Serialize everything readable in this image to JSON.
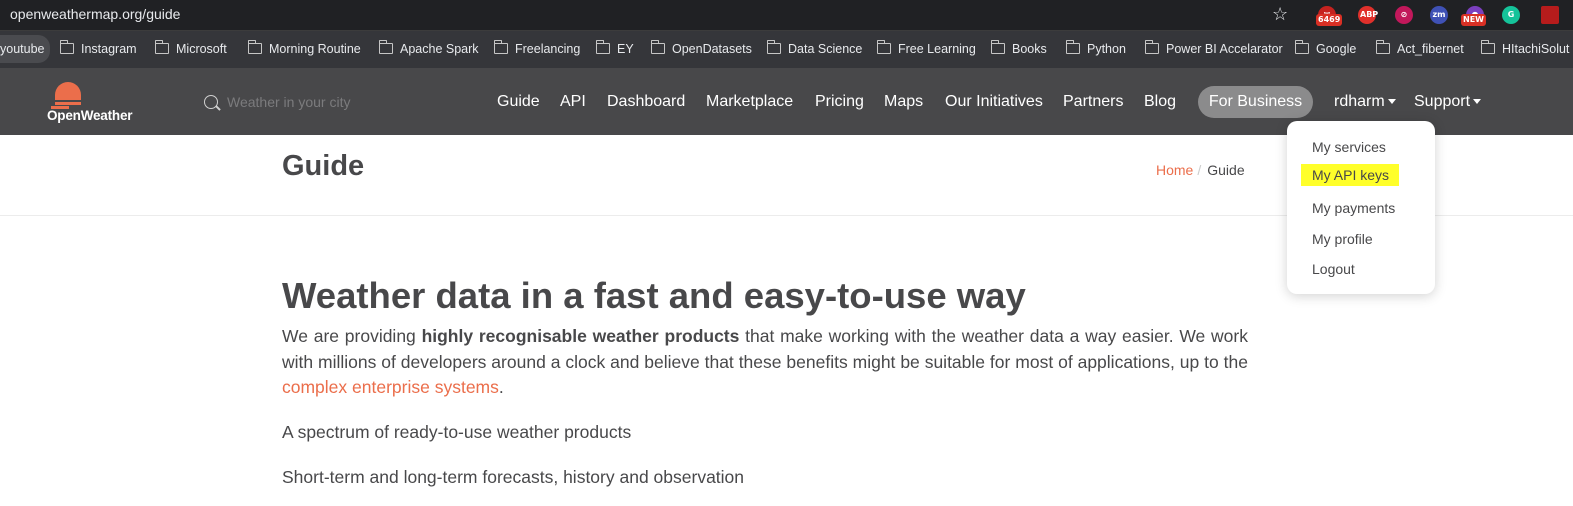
{
  "browser": {
    "url": "openweathermap.org/guide",
    "extensions": [
      {
        "name": "gmail-extension-icon",
        "badge": "6469"
      },
      {
        "name": "adblock-plus-icon",
        "label": "ABP"
      },
      {
        "name": "block-icon",
        "label": "⊘"
      },
      {
        "name": "zoom-icon",
        "label": "zm"
      },
      {
        "name": "new-extension-icon",
        "badge": "NEW"
      },
      {
        "name": "grammarly-icon",
        "label": "G"
      }
    ]
  },
  "bookmarks": [
    "youtube",
    "Instagram",
    "Microsoft",
    "Morning Routine",
    "Apache Spark",
    "Freelancing",
    "EY",
    "OpenDatasets",
    "Data Science",
    "Free Learning",
    "Books",
    "Python",
    "Power BI Accelarator",
    "Google",
    "Act_fibernet",
    "HItachiSolut"
  ],
  "nav": {
    "logo_text": "OpenWeather",
    "search_placeholder": "Weather in your city",
    "links": [
      "Guide",
      "API",
      "Dashboard",
      "Marketplace",
      "Pricing",
      "Maps",
      "Our Initiatives",
      "Partners",
      "Blog"
    ],
    "for_business": "For Business",
    "user": "rdharm",
    "support": "Support"
  },
  "user_menu": {
    "items": [
      "My services",
      "My API keys",
      "My payments",
      "My profile",
      "Logout"
    ],
    "highlighted": "My API keys",
    "highlight_color": "#ffff2a"
  },
  "header": {
    "title": "Guide",
    "breadcrumb_home": "Home",
    "breadcrumb_sep": "/",
    "breadcrumb_current": "Guide"
  },
  "content": {
    "heading": "Weather data in a fast and easy-to-use way",
    "lead_before": "We are providing ",
    "lead_bold": "highly recognisable weather products",
    "lead_after": " that make working with the weather data a way easier. We work with millions of developers around a clock and believe that these benefits might be suitable for most of applications, up to the ",
    "lead_link": "complex enterprise systems",
    "lead_end": ".",
    "p1": "A spectrum of ready-to-use weather products",
    "p2": "Short-term and long-term forecasts, history and observation"
  },
  "colors": {
    "brand": "#eb6e4b",
    "nav_bg": "#48484a",
    "text": "#48484a"
  }
}
